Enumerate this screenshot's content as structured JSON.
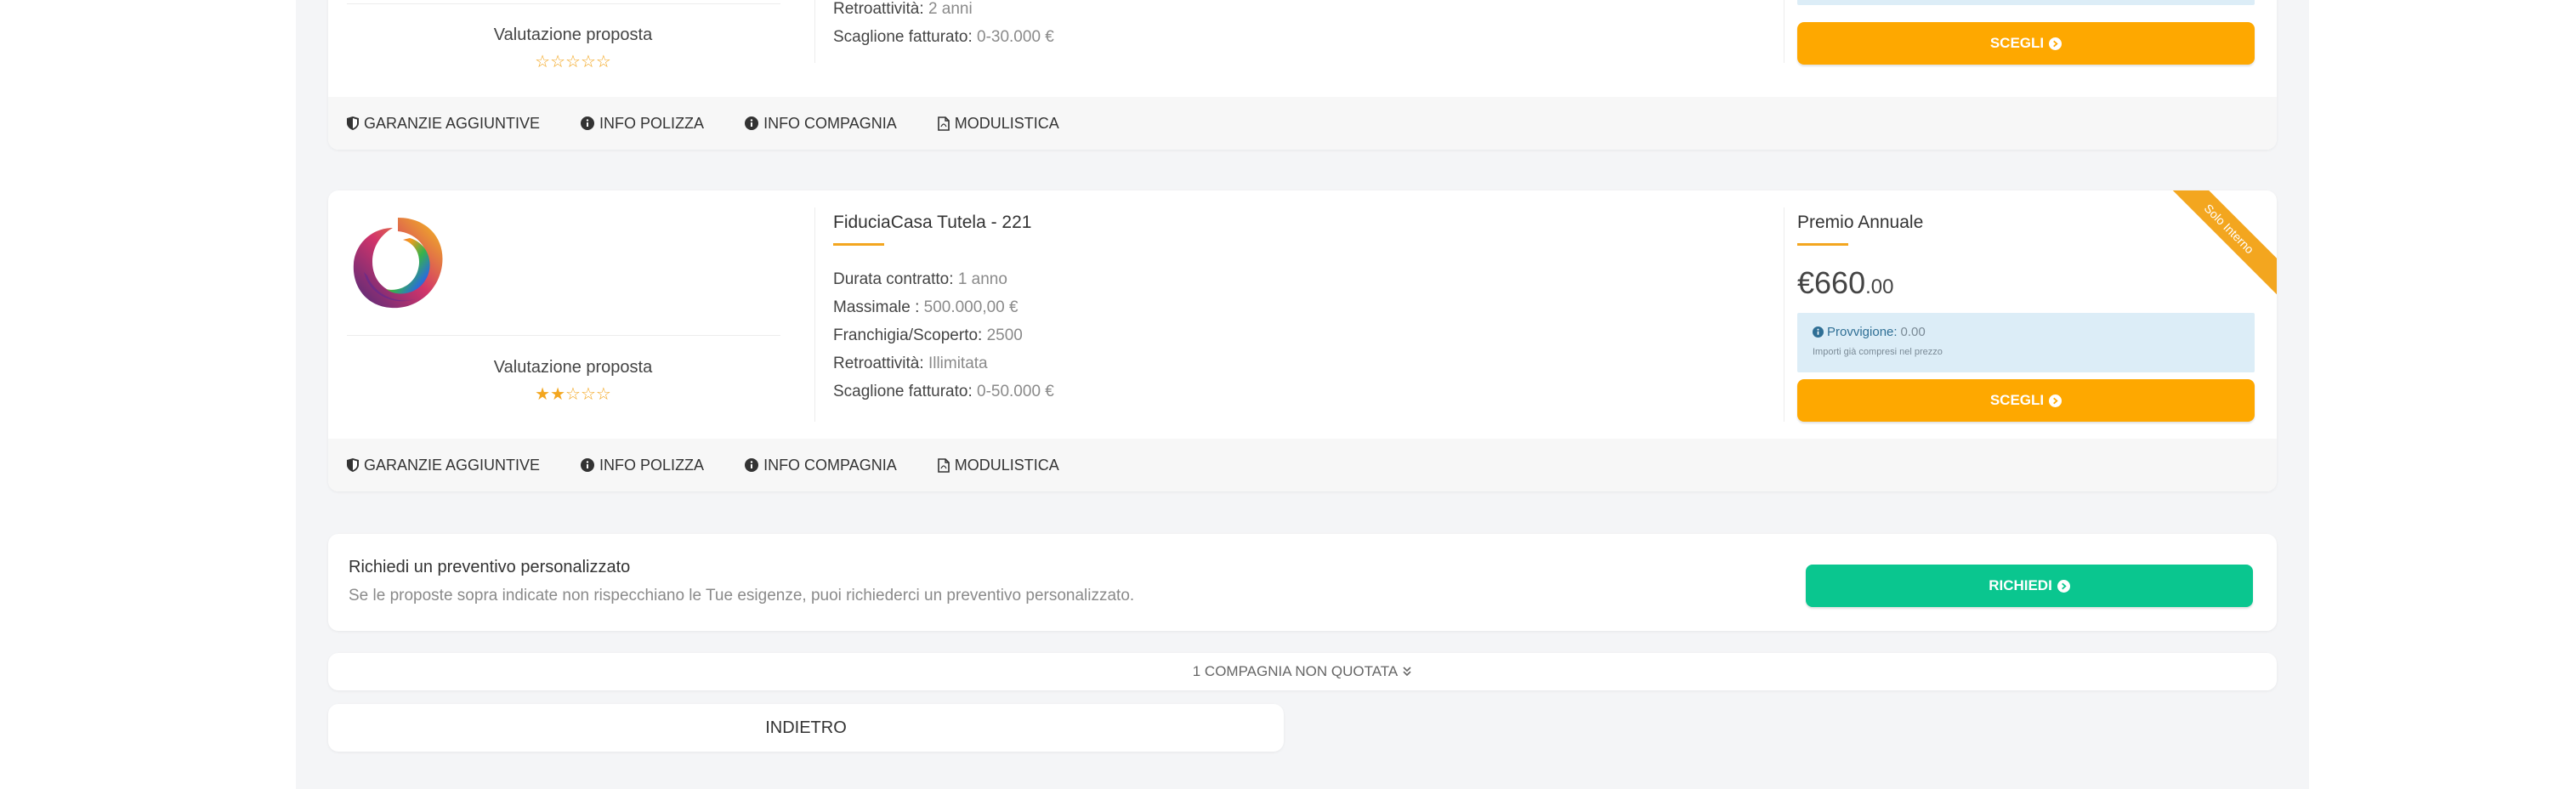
{
  "colors": {
    "accent_orange": "#fea800",
    "accent_green": "#0ac68f",
    "star": "#f3a61f",
    "info_bg": "#dcedf7",
    "ribbon": "#f3a61f"
  },
  "card1": {
    "evaluation_label": "Valutazione proposta",
    "rating_filled": 0,
    "rating_total": 5,
    "details": [
      {
        "label": "Retroattività:",
        "value": "2 anni"
      },
      {
        "label": "Scaglione fatturato:",
        "value": "0-30.000 €"
      }
    ],
    "choose_label": "SCEGLI",
    "footer": {
      "guarantees": "GARANZIE AGGIUNTIVE",
      "policy_info": "INFO POLIZZA",
      "company_info": "INFO COMPAGNIA",
      "forms": "MODULISTICA"
    }
  },
  "card2": {
    "product_title": "FiduciaCasa Tutela - 221",
    "evaluation_label": "Valutazione proposta",
    "rating_filled": 2,
    "rating_total": 5,
    "details": [
      {
        "label": "Durata contratto:",
        "value": "1 anno"
      },
      {
        "label": "Massimale :",
        "value": "500.000,00 €"
      },
      {
        "label": "Franchigia/Scoperto:",
        "value": "2500"
      },
      {
        "label": "Retroattività:",
        "value": "Illimitata"
      },
      {
        "label": "Scaglione fatturato:",
        "value": "0-50.000 €"
      }
    ],
    "premium_title": "Premio Annuale",
    "price_main": "€660",
    "price_cents": ".00",
    "commission_label": "Provvigione:",
    "commission_value": "0.00",
    "commission_note": "Importi già compresi nel prezzo",
    "ribbon_text": "Solo Interno",
    "choose_label": "SCEGLI",
    "footer": {
      "guarantees": "GARANZIE AGGIUNTIVE",
      "policy_info": "INFO POLIZZA",
      "company_info": "INFO COMPAGNIA",
      "forms": "MODULISTICA"
    }
  },
  "custom_quote": {
    "title": "Richiedi un preventivo personalizzato",
    "description": "Se le proposte sopra indicate non rispecchiano le Tue esigenze, puoi richiederci un preventivo personalizzato.",
    "button_label": "RICHIEDI"
  },
  "not_quoted": {
    "label": "1 COMPAGNIA NON QUOTATA",
    "icon": "double-chevron-down-icon"
  },
  "back": {
    "label": "INDIETRO"
  }
}
